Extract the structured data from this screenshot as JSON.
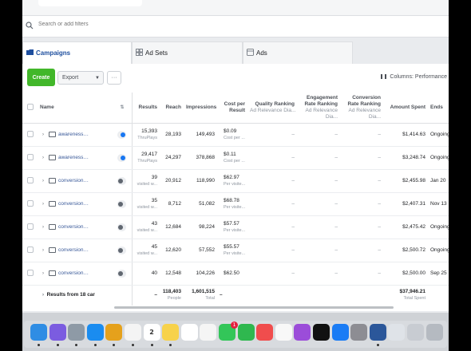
{
  "search": {
    "placeholder": "Search or add filters"
  },
  "tabs": [
    {
      "label": "Campaigns"
    },
    {
      "label": "Ad Sets"
    },
    {
      "label": "Ads"
    }
  ],
  "toolbar": {
    "create_label": "Create",
    "export_label": "Export",
    "more_label": "···",
    "columns_label": "Columns: Performance"
  },
  "table": {
    "headers": {
      "name": "Name",
      "results": "Results",
      "reach": "Reach",
      "impressions": "Impressions",
      "cost_per_result": "Cost per Result",
      "quality_ranking": "Quality Ranking",
      "quality_sub": "Ad Relevance Dia...",
      "engagement_ranking": "Engagement Rate Ranking",
      "engagement_sub": "Ad Relevance Dia...",
      "conversion_ranking": "Conversion Rate Ranking",
      "conversion_sub": "Ad Relevance Dia...",
      "amount_spent": "Amount Spent",
      "ends": "Ends"
    },
    "rows": [
      {
        "name": "awareness_...",
        "active": true,
        "results": "15,393",
        "results_sub": "ThruPlays",
        "reach": "28,193",
        "impressions": "149,493",
        "cost": "$0.09",
        "cost_sub": "Cost per ...",
        "quality": "–",
        "engagement": "–",
        "conversion": "–",
        "amount": "$1,414.63",
        "ends": "Ongoing"
      },
      {
        "name": "awareness_...",
        "active": true,
        "results": "29,417",
        "results_sub": "ThruPlays",
        "reach": "24,297",
        "impressions": "378,868",
        "cost": "$0.11",
        "cost_sub": "Cost per ...",
        "quality": "–",
        "engagement": "–",
        "conversion": "–",
        "amount": "$3,248.74",
        "ends": "Ongoing"
      },
      {
        "name": "conversions...",
        "active": false,
        "results": "39",
        "results_sub": "visited w...",
        "reach": "20,912",
        "impressions": "118,990",
        "cost": "$62.97",
        "cost_sub": "Per visite...",
        "quality": "–",
        "engagement": "–",
        "conversion": "–",
        "amount": "$2,455.98",
        "ends": "Jan 20"
      },
      {
        "name": "conversions...",
        "active": false,
        "results": "35",
        "results_sub": "visited w...",
        "reach": "8,712",
        "impressions": "51,082",
        "cost": "$68.78",
        "cost_sub": "Per visite...",
        "quality": "–",
        "engagement": "–",
        "conversion": "–",
        "amount": "$2,407.31",
        "ends": "Nov 13"
      },
      {
        "name": "conversions...",
        "active": false,
        "results": "43",
        "results_sub": "visited w...",
        "reach": "12,684",
        "impressions": "98,224",
        "cost": "$57.57",
        "cost_sub": "Per visite...",
        "quality": "–",
        "engagement": "–",
        "conversion": "–",
        "amount": "$2,475.42",
        "ends": "Ongoing"
      },
      {
        "name": "conversions...",
        "active": false,
        "results": "45",
        "results_sub": "visited w...",
        "reach": "12,620",
        "impressions": "57,552",
        "cost": "$55.57",
        "cost_sub": "Per visite...",
        "quality": "–",
        "engagement": "–",
        "conversion": "–",
        "amount": "$2,500.72",
        "ends": "Ongoing"
      },
      {
        "name": "conversions...",
        "active": false,
        "results": "40",
        "results_sub": "",
        "reach": "12,548",
        "impressions": "104,226",
        "cost": "$62.50",
        "cost_sub": "",
        "quality": "–",
        "engagement": "–",
        "conversion": "–",
        "amount": "$2,500.00",
        "ends": "Sep 25"
      }
    ],
    "totals": {
      "label": "Results from 18 car",
      "results": "–",
      "reach": "118,403",
      "reach_sub": "People",
      "impressions": "1,601,515",
      "impressions_sub": "Total",
      "cost": "–",
      "amount": "$37,946.21",
      "amount_sub": "Total Spent"
    }
  },
  "dock": {
    "calendar_day": "2",
    "mail_badge": "1",
    "icons": [
      "finder-icon",
      "siri-icon",
      "launchpad-icon",
      "safari-icon",
      "chrome-icon",
      "photos-app-icon",
      "calendar-icon",
      "notes-icon",
      "reminders-icon",
      "photos-icon",
      "messages-icon",
      "facetime-icon",
      "news-icon",
      "music-icon",
      "podcasts-icon",
      "apple-tv-icon",
      "app-store-icon",
      "system-preferences-icon",
      "word-icon",
      "preview-icon",
      "disk-icon",
      "trash-icon"
    ]
  }
}
